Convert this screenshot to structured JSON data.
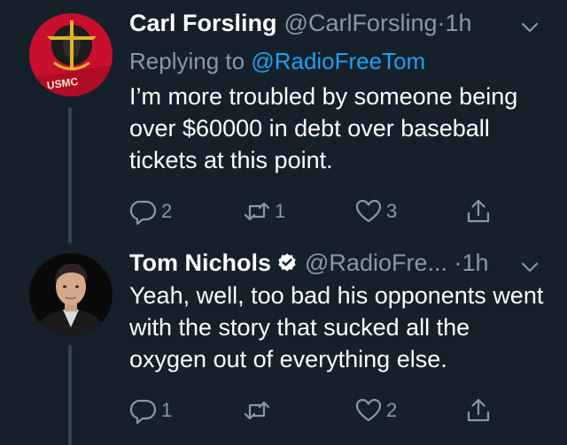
{
  "tweets": [
    {
      "avatar_text": "USMC",
      "name": "Carl Forsling",
      "handle": "@CarlForsling",
      "dot": "·",
      "time": "1h",
      "replying_prefix": "Replying to",
      "replying_mention": "@RadioFreeTom",
      "text": "I’m more troubled by someone being over $60000 in debt over baseball tickets at this point.",
      "replies": "2",
      "retweets": "1",
      "likes": "3"
    },
    {
      "name": "Tom Nichols",
      "handle": "@RadioFre...",
      "dot": "·",
      "time": "1h",
      "text": "Yeah, well, too bad his opponents went with the story that sucked all the oxygen out of everything else.",
      "replies": "1",
      "retweets": "",
      "likes": "2"
    }
  ],
  "icons": {
    "reply": "reply-icon",
    "retweet": "retweet-icon",
    "like": "heart-icon",
    "share": "share-icon",
    "menu": "chevron-down-icon",
    "verified": "verified-badge-icon"
  },
  "colors": {
    "background": "#15202b",
    "text": "#ffffff",
    "muted": "#8899a6",
    "accent": "#1da1f2",
    "thread_line": "#38444d"
  }
}
